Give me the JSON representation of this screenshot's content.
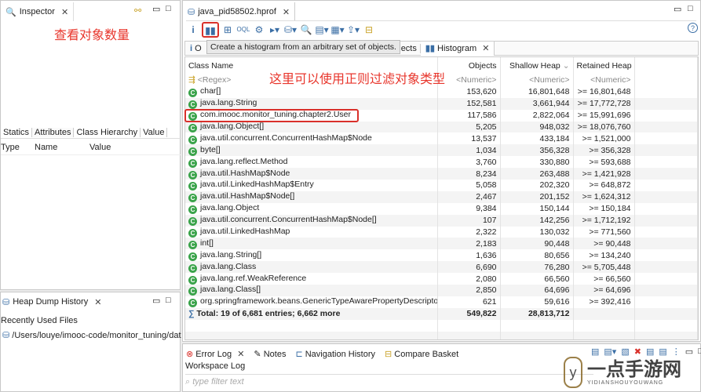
{
  "inspector": {
    "tab": "Inspector",
    "annotation": "查看对象数量",
    "tabs": [
      "Statics",
      "Attributes",
      "Class Hierarchy",
      "Value"
    ],
    "columns": [
      "Type",
      "Name",
      "Value"
    ]
  },
  "heap_history": {
    "tab": "Heap Dump History",
    "section": "Recently Used Files",
    "files": [
      "/Users/louye/imooc-code/monitor_tuning/data"
    ]
  },
  "editor": {
    "tab": "java_pid58502.hprof",
    "tooltip": "Create a histogram from an arbitrary set of objects.",
    "inner_tabs": [
      "O",
      "ects",
      "Histogram"
    ],
    "annotation": "这里可以使用正则过滤对象类型"
  },
  "table": {
    "columns": [
      "Class Name",
      "Objects",
      "Shallow Heap",
      "Retained Heap"
    ],
    "filter": [
      "<Regex>",
      "<Numeric>",
      "<Numeric>",
      "<Numeric>"
    ],
    "rows": [
      [
        "char[]",
        "153,620",
        "16,801,648",
        ">= 16,801,648"
      ],
      [
        "java.lang.String",
        "152,581",
        "3,661,944",
        ">= 17,772,728"
      ],
      [
        "com.imooc.monitor_tuning.chapter2.User",
        "117,586",
        "2,822,064",
        ">= 15,991,696"
      ],
      [
        "java.lang.Object[]",
        "5,205",
        "948,032",
        ">= 18,076,760"
      ],
      [
        "java.util.concurrent.ConcurrentHashMap$Node",
        "13,537",
        "433,184",
        ">= 1,521,000"
      ],
      [
        "byte[]",
        "1,034",
        "356,328",
        ">= 356,328"
      ],
      [
        "java.lang.reflect.Method",
        "3,760",
        "330,880",
        ">= 593,688"
      ],
      [
        "java.util.HashMap$Node",
        "8,234",
        "263,488",
        ">= 1,421,928"
      ],
      [
        "java.util.LinkedHashMap$Entry",
        "5,058",
        "202,320",
        ">= 648,872"
      ],
      [
        "java.util.HashMap$Node[]",
        "2,467",
        "201,152",
        ">= 1,624,312"
      ],
      [
        "java.lang.Object",
        "9,384",
        "150,144",
        ">= 150,184"
      ],
      [
        "java.util.concurrent.ConcurrentHashMap$Node[]",
        "107",
        "142,256",
        ">= 1,712,192"
      ],
      [
        "java.util.LinkedHashMap",
        "2,322",
        "130,032",
        ">= 771,560"
      ],
      [
        "int[]",
        "2,183",
        "90,448",
        ">= 90,448"
      ],
      [
        "java.lang.String[]",
        "1,636",
        "80,656",
        ">= 134,240"
      ],
      [
        "java.lang.Class",
        "6,690",
        "76,280",
        ">= 5,705,448"
      ],
      [
        "java.lang.ref.WeakReference",
        "2,080",
        "66,560",
        ">= 66,560"
      ],
      [
        "java.lang.Class[]",
        "2,850",
        "64,696",
        ">= 64,696"
      ],
      [
        "org.springframework.beans.GenericTypeAwarePropertyDescriptor",
        "621",
        "59,616",
        ">= 392,416"
      ]
    ],
    "total": {
      "label": "Total: 19 of 6,681 entries; 6,662 more",
      "objects": "549,822",
      "shallow": "28,813,712"
    }
  },
  "bottom": {
    "tabs": [
      "Error Log",
      "Notes",
      "Navigation History",
      "Compare Basket"
    ],
    "section": "Workspace Log",
    "filter_placeholder": "type filter text"
  },
  "watermark": {
    "text": "一点手游网",
    "sub": "YIDIANSHOUYOUWANG"
  },
  "colors": {
    "annotation": "#e8362c",
    "class_icon": "#3aa34a",
    "highlight_box": "#d9302a"
  }
}
